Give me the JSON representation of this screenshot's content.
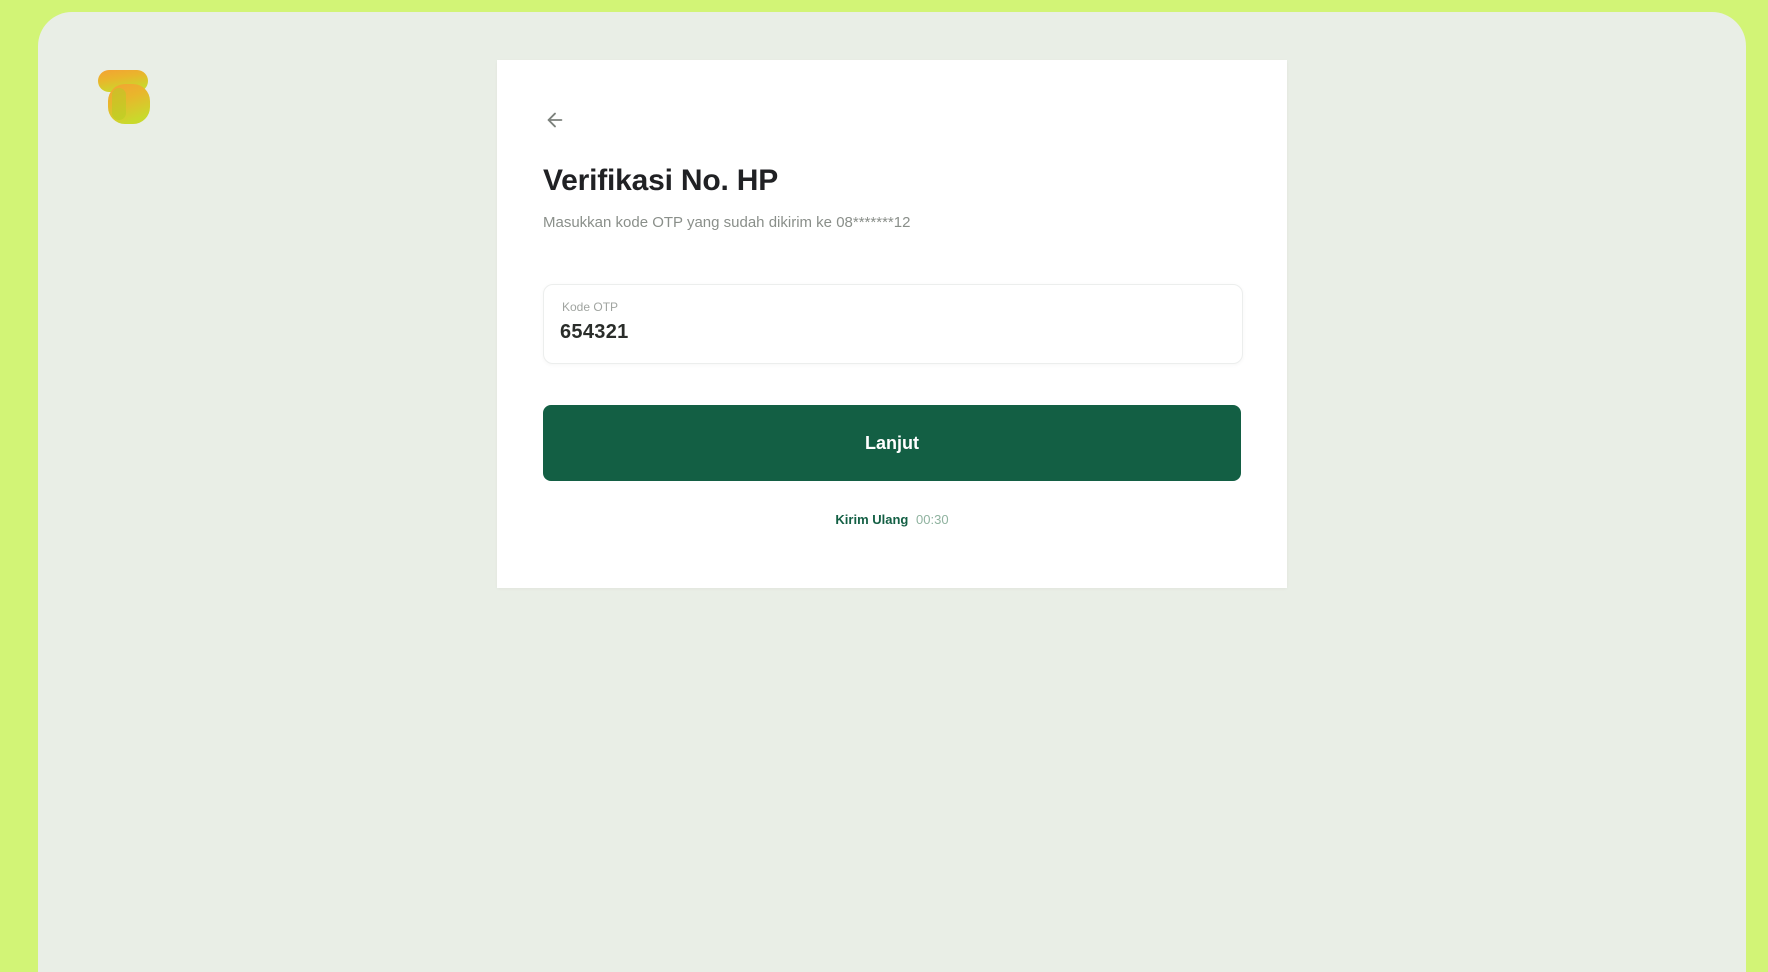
{
  "brand": {
    "logo_icon": "brand-logo-icon",
    "colors": {
      "top": "#f4a233",
      "bottom": "#c9d92c",
      "accent": "#135f44",
      "page_bg": "#d2f476",
      "frame_bg": "#e9eee6"
    }
  },
  "card": {
    "back_icon": "arrow-left-icon",
    "title": "Verifikasi No. HP",
    "subtitle": "Masukkan kode OTP yang sudah dikirim ke 08*******12",
    "otp": {
      "label": "Kode OTP",
      "value": "654321"
    },
    "submit_label": "Lanjut",
    "resend": {
      "link_label": "Kirim Ulang",
      "timer": "00:30"
    }
  }
}
